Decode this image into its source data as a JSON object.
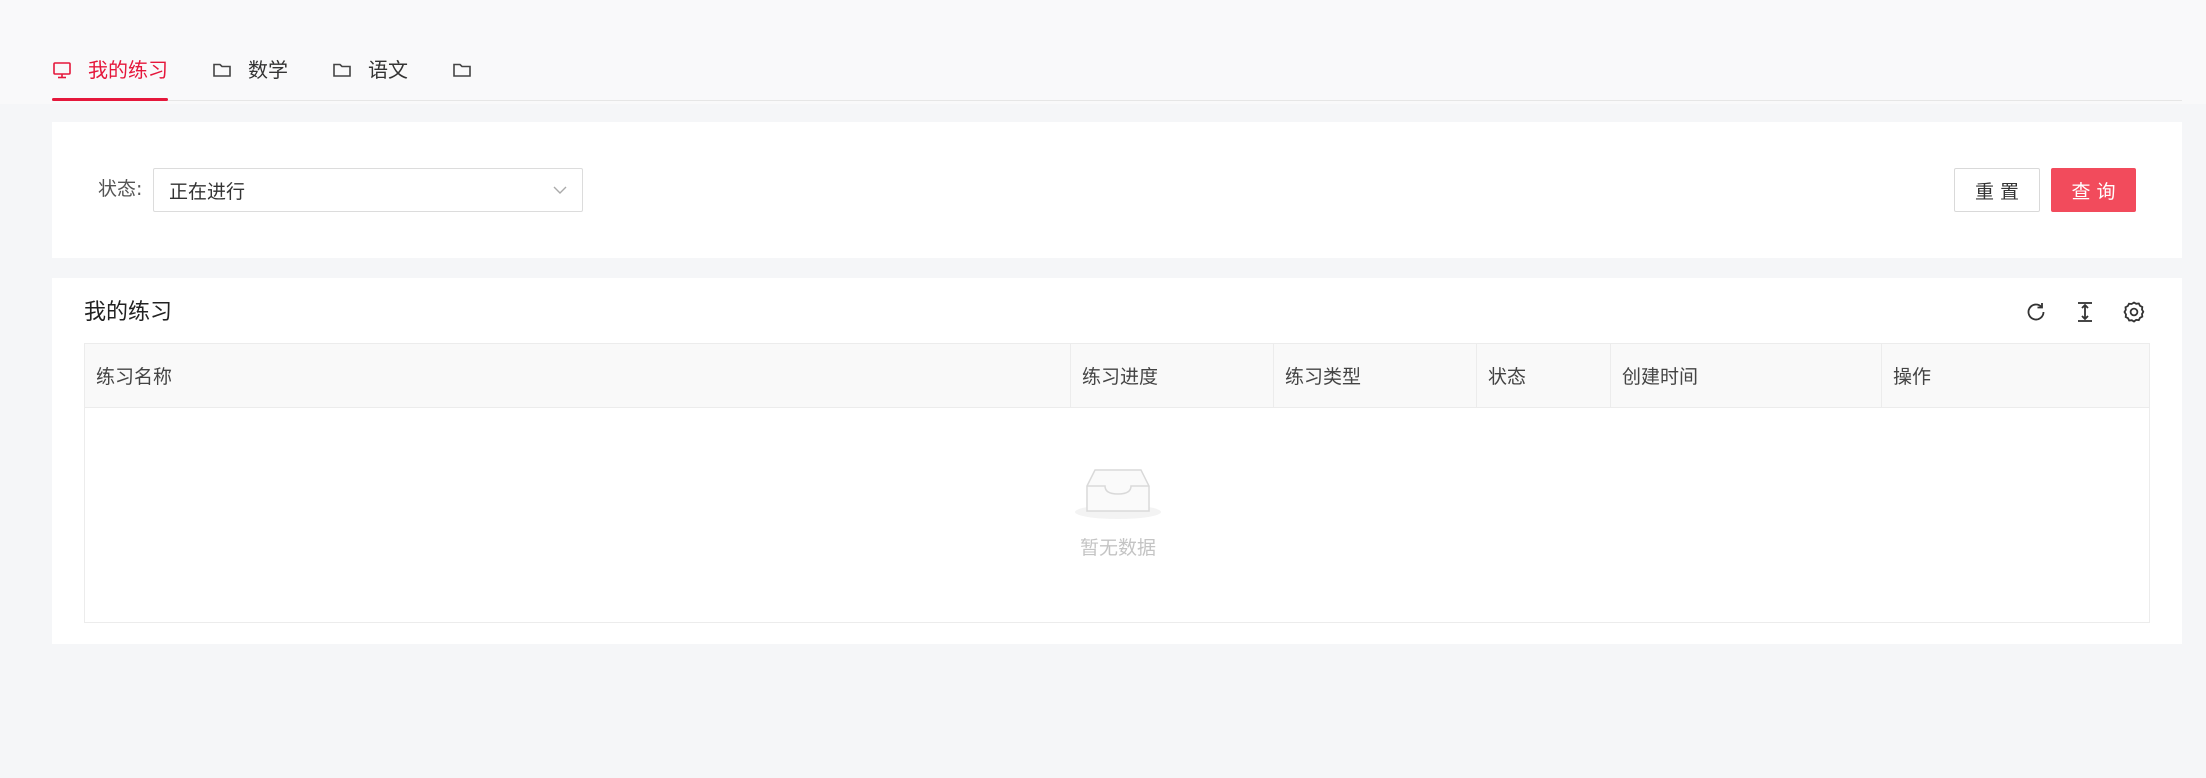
{
  "tabs": [
    {
      "label": "我的练习",
      "icon": "monitor-icon",
      "active": true
    },
    {
      "label": "数学",
      "icon": "folder-icon",
      "active": false
    },
    {
      "label": "语文",
      "icon": "folder-icon",
      "active": false
    },
    {
      "label": "",
      "icon": "folder-icon",
      "active": false
    }
  ],
  "search": {
    "status_label": "状态:",
    "status_value": "正在进行",
    "reset_label": "重置",
    "query_label": "查询"
  },
  "table_card": {
    "title": "我的练习",
    "tools": [
      "refresh-icon",
      "column-height-icon",
      "settings-icon"
    ],
    "columns": [
      "练习名称",
      "练习进度",
      "练习类型",
      "状态",
      "创建时间",
      "操作"
    ],
    "rows": [],
    "empty_text": "暂无数据"
  },
  "colors": {
    "accent": "#e5173b",
    "primary_button": "#f24b5c",
    "background": "#f5f6f8"
  }
}
